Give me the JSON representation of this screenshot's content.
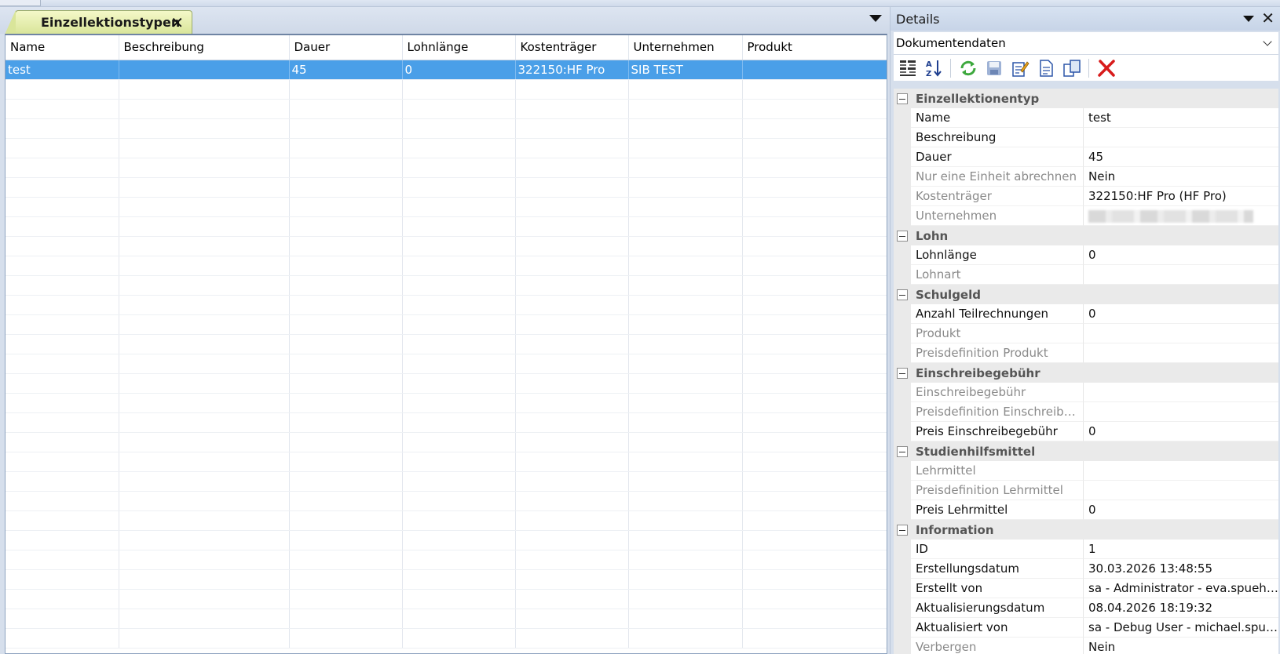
{
  "document_tab": {
    "title": "Einzellektionstypen",
    "close_glyph": "✕"
  },
  "grid": {
    "columns": [
      "Name",
      "Beschreibung",
      "Dauer",
      "Lohnlänge",
      "Kostenträger",
      "Unternehmen",
      "Produkt"
    ],
    "rows": [
      {
        "selected": true,
        "cells": [
          "test",
          "",
          "45",
          "0",
          "322150:HF Pro",
          "SIB TEST",
          ""
        ]
      }
    ]
  },
  "details": {
    "title": "Details",
    "close_glyph": "✕",
    "view_select": "Dokumentendaten",
    "toolbar_icons": [
      "categorized-icon",
      "sort-alpha-icon",
      "refresh-icon",
      "save-icon",
      "edit-icon",
      "new-document-icon",
      "copy-icon",
      "delete-icon"
    ],
    "categories": [
      {
        "label": "Einzellektionentyp",
        "props": [
          {
            "name": "Name",
            "value": "test",
            "readonly": false
          },
          {
            "name": "Beschreibung",
            "value": "",
            "readonly": false
          },
          {
            "name": "Dauer",
            "value": "45",
            "readonly": false
          },
          {
            "name": "Nur eine Einheit abrechnen",
            "value": "Nein",
            "readonly": true
          },
          {
            "name": "Kostenträger",
            "value": "322150:HF Pro (HF Pro)",
            "readonly": true
          },
          {
            "name": "Unternehmen",
            "value": "",
            "readonly": true,
            "blurred": true
          }
        ]
      },
      {
        "label": "Lohn",
        "props": [
          {
            "name": "Lohnlänge",
            "value": "0",
            "readonly": false
          },
          {
            "name": "Lohnart",
            "value": "",
            "readonly": true
          }
        ]
      },
      {
        "label": "Schulgeld",
        "props": [
          {
            "name": "Anzahl Teilrechnungen",
            "value": "0",
            "readonly": false
          },
          {
            "name": "Produkt",
            "value": "",
            "readonly": true
          },
          {
            "name": "Preisdefinition Produkt",
            "value": "",
            "readonly": true
          }
        ]
      },
      {
        "label": "Einschreibegebühr",
        "props": [
          {
            "name": "Einschreibegebühr",
            "value": "",
            "readonly": true
          },
          {
            "name": "Preisdefinition Einschreibgeb...",
            "value": "",
            "readonly": true
          },
          {
            "name": "Preis Einschreibegebühr",
            "value": "0",
            "readonly": false
          }
        ]
      },
      {
        "label": "Studienhilfsmittel",
        "props": [
          {
            "name": "Lehrmittel",
            "value": "",
            "readonly": true
          },
          {
            "name": "Preisdefinition Lehrmittel",
            "value": "",
            "readonly": true
          },
          {
            "name": "Preis Lehrmittel",
            "value": "0",
            "readonly": false
          }
        ]
      },
      {
        "label": "Information",
        "props": [
          {
            "name": "ID",
            "value": "1",
            "readonly": false
          },
          {
            "name": "Erstellungsdatum",
            "value": "30.03.2026 13:48:55",
            "readonly": false
          },
          {
            "name": "Erstellt von",
            "value": "sa - Administrator - eva.spuehler",
            "readonly": false
          },
          {
            "name": "Aktualisierungsdatum",
            "value": "08.04.2026 18:19:32",
            "readonly": false
          },
          {
            "name": "Aktualisiert von",
            "value": "sa - Debug User - michael.spueh...",
            "readonly": false
          },
          {
            "name": "Verbergen",
            "value": "Nein",
            "readonly": true
          }
        ]
      }
    ]
  }
}
